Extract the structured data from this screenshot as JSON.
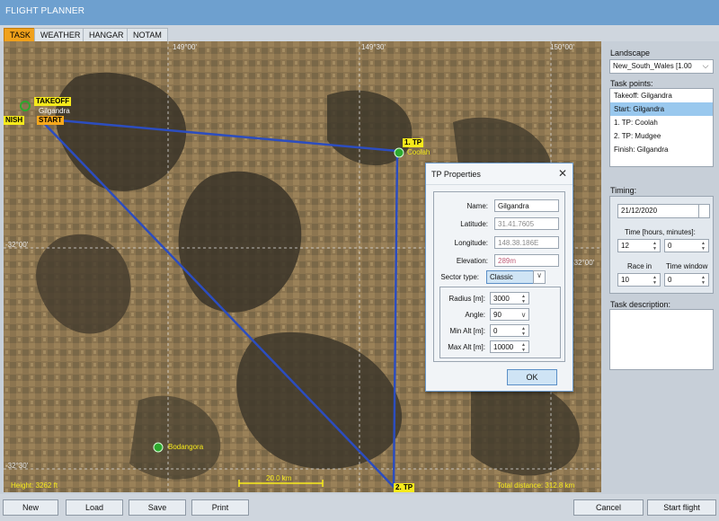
{
  "window": {
    "title": "FLIGHT PLANNER"
  },
  "tabs": [
    {
      "label": "TASK",
      "active": true
    },
    {
      "label": "WEATHER",
      "active": false
    },
    {
      "label": "HANGAR",
      "active": false
    },
    {
      "label": "NOTAM",
      "active": false
    }
  ],
  "map": {
    "labels": {
      "takeoff": "TAKEOFF",
      "gilgandra": "Gilgandra",
      "start": "START",
      "finish": "NISH",
      "tp1": "1. TP",
      "coolah": "Coolah",
      "tp2": "2. TP",
      "bodangora": "Bodangora",
      "scale": "20.0 km",
      "height": "Height: 3262 ft",
      "total_distance": "Total distance: 312.8 km"
    },
    "coords": {
      "lon1": "149°00'",
      "lon2": "149°30'",
      "lon3": "150°00'",
      "lat1": "-32°00'",
      "lat1_right": "-32°00'",
      "lat2": "-32°30'"
    },
    "colors": {
      "route": "#2c4dbf",
      "grid": "#d8d8d8",
      "marker_yellow": "#f6ea1b",
      "marker_orange": "#f6a81c"
    }
  },
  "sidebar": {
    "landscape_label": "Landscape",
    "landscape_value": "New_South_Wales [1.00",
    "taskpoints_label": "Task points:",
    "taskpoints": [
      {
        "label": "Takeoff: Gilgandra",
        "selected": false
      },
      {
        "label": "Start: Gilgandra",
        "selected": true
      },
      {
        "label": "1. TP: Coolah",
        "selected": false
      },
      {
        "label": "2. TP: Mudgee",
        "selected": false
      },
      {
        "label": "Finish: Gilgandra",
        "selected": false
      }
    ],
    "timing_label": "Timing:",
    "date": "21/12/2020",
    "time_label": "Time [hours, minutes]:",
    "time_hours": "12",
    "time_minutes": "0",
    "race_in_label": "Race in",
    "time_window_label": "Time window",
    "race_in": "10",
    "time_window": "0",
    "description_label": "Task description:"
  },
  "dialog": {
    "title": "TP Properties",
    "name_label": "Name:",
    "name": "Gilgandra",
    "latitude_label": "Latitude:",
    "latitude": "31.41.7605",
    "longitude_label": "Longitude:",
    "longitude": "148.38.186E",
    "elevation_label": "Elevation:",
    "elevation": "289m",
    "sector_type_label": "Sector type:",
    "sector_type": "Classic",
    "radius_label": "Radius [m]:",
    "radius": "3000",
    "angle_label": "Angle:",
    "angle": "90",
    "min_alt_label": "Min Alt [m]:",
    "min_alt": "0",
    "max_alt_label": "Max Alt [m]:",
    "max_alt": "10000",
    "ok_label": "OK"
  },
  "buttons": {
    "new": "New",
    "load": "Load",
    "save": "Save",
    "print": "Print",
    "cancel": "Cancel",
    "start_flight": "Start flight"
  }
}
